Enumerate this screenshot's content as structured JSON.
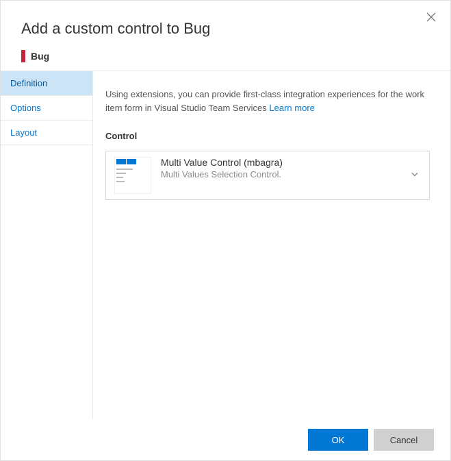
{
  "dialog": {
    "title": "Add a custom control to Bug",
    "work_item_type": "Bug",
    "work_item_color": "#c2273c"
  },
  "sidebar": {
    "items": [
      {
        "label": "Definition",
        "active": true
      },
      {
        "label": "Options",
        "active": false
      },
      {
        "label": "Layout",
        "active": false
      }
    ]
  },
  "main": {
    "description": "Using extensions, you can provide first-class integration experiences for the work item form in Visual Studio Team Services ",
    "learn_more": "Learn more",
    "section_label": "Control",
    "control": {
      "title": "Multi Value Control (mbagra)",
      "subtitle": "Multi Values Selection Control."
    }
  },
  "footer": {
    "ok": "OK",
    "cancel": "Cancel"
  }
}
